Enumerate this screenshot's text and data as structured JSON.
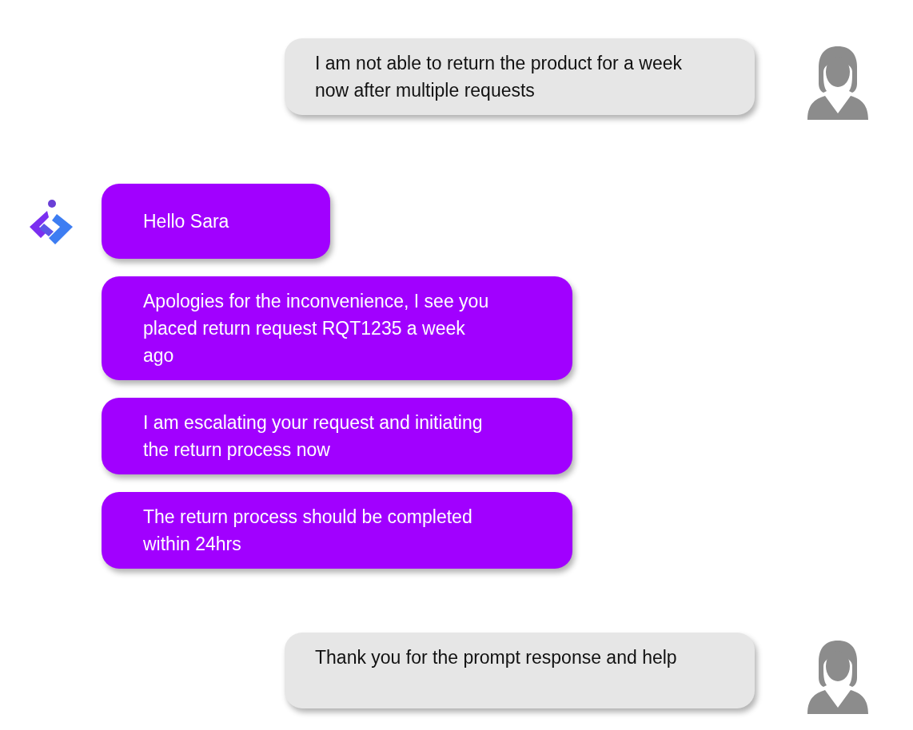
{
  "messages": [
    {
      "kind": "user",
      "text": "I am not able to return the product for a week now after multiple requests"
    },
    {
      "kind": "bot",
      "text": "Hello Sara"
    },
    {
      "kind": "bot",
      "text": "Apologies for the inconvenience, I see you placed return request RQT1235 a week ago"
    },
    {
      "kind": "bot",
      "text": "I am escalating your request and initiating the return process now"
    },
    {
      "kind": "bot",
      "text": "The return process should be completed within 24hrs"
    },
    {
      "kind": "user",
      "text": "Thank you for the prompt response and help"
    }
  ]
}
